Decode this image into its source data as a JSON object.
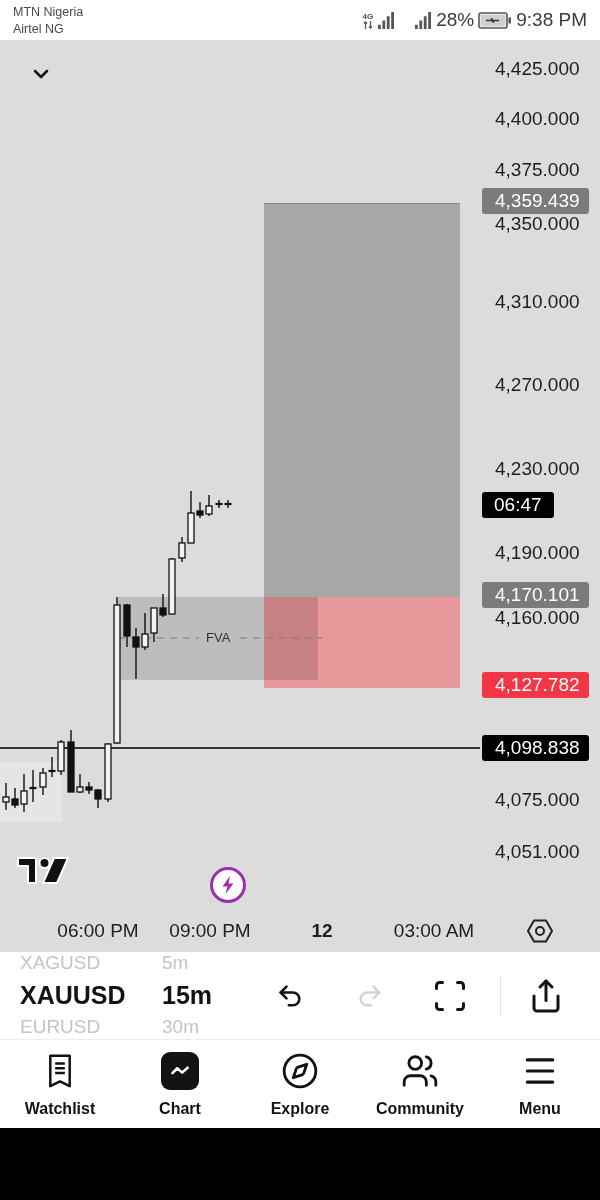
{
  "status_bar": {
    "carriers": [
      "MTN Nigeria",
      "Airtel NG"
    ],
    "network": "4G",
    "battery": "28%",
    "time": "9:38 PM"
  },
  "chart": {
    "zone_label": "FVA",
    "price_axis": [
      {
        "kind": "tick",
        "label": "4,425.000"
      },
      {
        "kind": "tick",
        "label": "4,400.000"
      },
      {
        "kind": "tick",
        "label": "4,375.000"
      },
      {
        "kind": "tag",
        "label": "4,359.439",
        "color": "#7b7b7b"
      },
      {
        "kind": "tick",
        "label": "4,350.000"
      },
      {
        "kind": "tick",
        "label": "4,310.000"
      },
      {
        "kind": "tick",
        "label": "4,270.000"
      },
      {
        "kind": "tick",
        "label": "4,230.000"
      },
      {
        "kind": "countdown",
        "label": "06:47",
        "color": "#000000"
      },
      {
        "kind": "tick",
        "label": "4,190.000"
      },
      {
        "kind": "tag",
        "label": "4,170.101",
        "color": "#7b7b7b"
      },
      {
        "kind": "tick",
        "label": "4,160.000"
      },
      {
        "kind": "tag",
        "label": "4,127.782",
        "color": "#f23645"
      },
      {
        "kind": "tag",
        "label": "4,098.838",
        "color": "#000000"
      },
      {
        "kind": "tick",
        "label": "4,075.000"
      },
      {
        "kind": "tick",
        "label": "4,051.000"
      }
    ],
    "time_axis": [
      {
        "kind": "time",
        "label": "06:00 PM"
      },
      {
        "kind": "time",
        "label": "09:00 PM"
      },
      {
        "kind": "date",
        "label": "12"
      },
      {
        "kind": "time",
        "label": "03:00 AM"
      }
    ]
  },
  "symbol_bar": {
    "symbols": [
      {
        "label": "XAGUSD",
        "selected": false
      },
      {
        "label": "XAUUSD",
        "selected": true
      },
      {
        "label": "EURUSD",
        "selected": false
      }
    ],
    "intervals": [
      {
        "label": "5m",
        "selected": false
      },
      {
        "label": "15m",
        "selected": true
      },
      {
        "label": "30m",
        "selected": false
      }
    ],
    "undo": {
      "disabled": false
    },
    "redo": {
      "disabled": true
    }
  },
  "bottom_nav": [
    {
      "label": "Watchlist",
      "selected": false
    },
    {
      "label": "Chart",
      "selected": true
    },
    {
      "label": "Explore",
      "selected": false
    },
    {
      "label": "Community",
      "selected": false
    },
    {
      "label": "Menu",
      "selected": false
    }
  ]
}
